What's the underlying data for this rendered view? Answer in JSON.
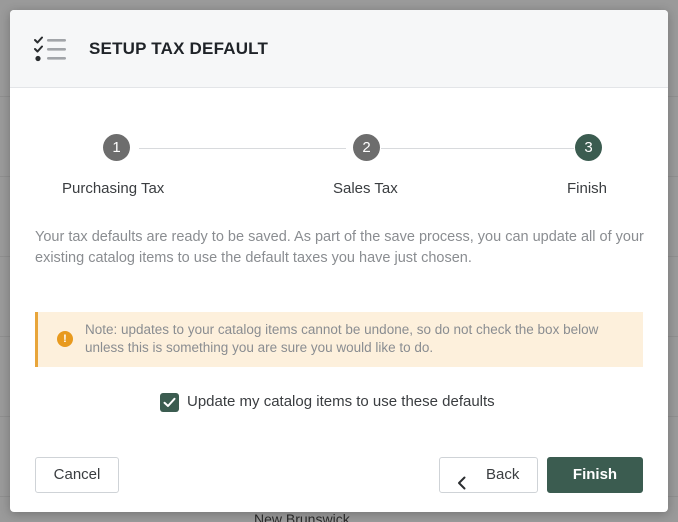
{
  "dialog": {
    "title": "SETUP TAX DEFAULT",
    "header_icon": "checklist-icon"
  },
  "stepper": {
    "steps": [
      {
        "number": "1",
        "label": "Purchasing Tax",
        "state": "done"
      },
      {
        "number": "2",
        "label": "Sales Tax",
        "state": "done"
      },
      {
        "number": "3",
        "label": "Finish",
        "state": "active"
      }
    ]
  },
  "body": {
    "info_text": "Your tax defaults are ready to be saved. As part of the save process, you can update all of your existing catalog items to use the default taxes you have just chosen.",
    "note": {
      "icon": "warning-icon",
      "icon_glyph": "!",
      "text": "Note: updates to your catalog items cannot be undone, so do not check the box below unless this is something you are sure you would like to do."
    },
    "checkbox": {
      "label": "Update my catalog items to use these defaults",
      "checked": true
    }
  },
  "footer": {
    "cancel_label": "Cancel",
    "back_label": "Back",
    "finish_label": "Finish"
  },
  "background": {
    "partial_text": "New Brunswick"
  },
  "colors": {
    "primary": "#3b5c50",
    "step_done": "#6d6d6d",
    "note_bg": "#fdf0dc",
    "note_accent": "#e8a53a"
  }
}
